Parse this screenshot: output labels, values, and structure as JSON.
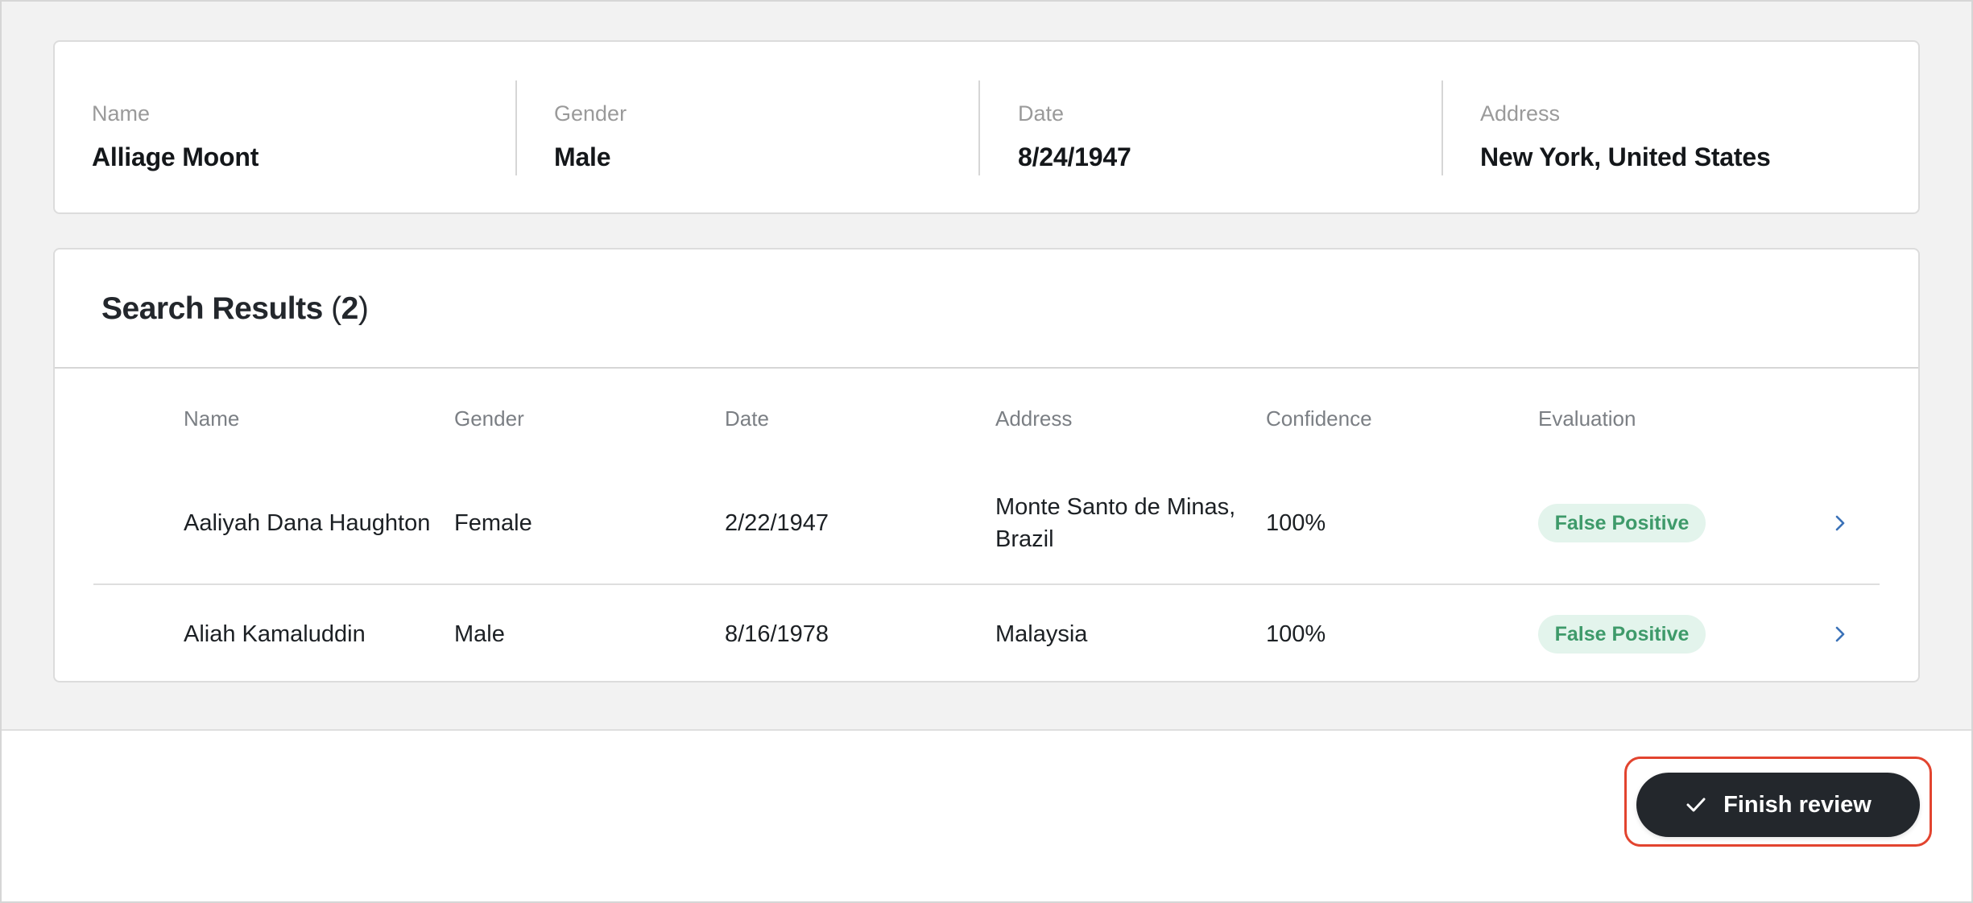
{
  "subject": {
    "fields": [
      {
        "label": "Name",
        "value": "Alliage Moont"
      },
      {
        "label": "Gender",
        "value": "Male"
      },
      {
        "label": "Date",
        "value": "8/24/1947"
      },
      {
        "label": "Address",
        "value": "New York, United States"
      }
    ]
  },
  "results": {
    "title": "Search Results",
    "open_paren": "(",
    "count": "2",
    "close_paren": ")",
    "columns": [
      "Name",
      "Gender",
      "Date",
      "Address",
      "Confidence",
      "Evaluation"
    ],
    "rows": [
      {
        "name": "Aaliyah Dana Haughton",
        "gender": "Female",
        "date": "2/22/1947",
        "address_line1": "Monte Santo de Minas,",
        "address_line2": "Brazil",
        "confidence": "100%",
        "evaluation": "False Positive",
        "icon": "chevron-right-icon"
      },
      {
        "name": "Aliah Kamaluddin",
        "gender": "Male",
        "date": "8/16/1978",
        "address_line1": "Malaysia",
        "address_line2": "",
        "confidence": "100%",
        "evaluation": "False Positive",
        "icon": "chevron-right-icon"
      }
    ]
  },
  "footer": {
    "finish_label": "Finish review",
    "finish_icon": "check-icon"
  },
  "colors": {
    "badge_bg": "#e3f4ec",
    "badge_text": "#3e9a6a",
    "chevron": "#3b72b8",
    "button_bg": "#23272c",
    "highlight_outline": "#e2442f"
  }
}
